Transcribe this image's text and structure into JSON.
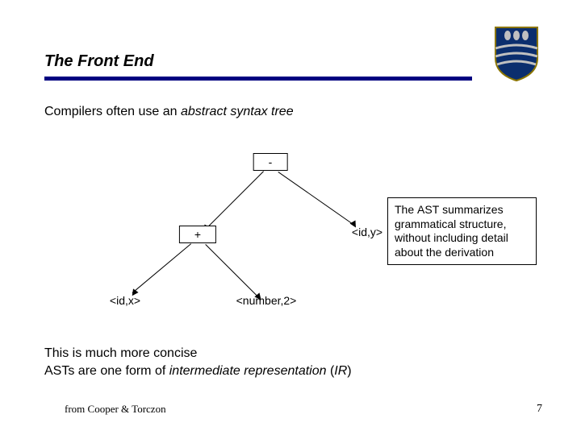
{
  "header": {
    "title": "The Front End"
  },
  "subtitle_before": "Compilers often use an ",
  "subtitle_italic": "abstract syntax tree",
  "tree": {
    "root": "-",
    "plus": "+",
    "idy": "<id,y>",
    "idx": "<id,x>",
    "num2": "<number,2>"
  },
  "note": {
    "line1a": "The ",
    "line1b": "AST",
    "line1c": " summarizes grammatical structure, without including detail about the derivation"
  },
  "bottom": {
    "line1": "This is much more concise",
    "line2a": "AST",
    "line2b": "s are one form of ",
    "line2c": "intermediate representation",
    "line2d": " (",
    "line2e": "IR",
    "line2f": ")"
  },
  "footer": {
    "left": "from Cooper & Torczon",
    "right": "7"
  }
}
